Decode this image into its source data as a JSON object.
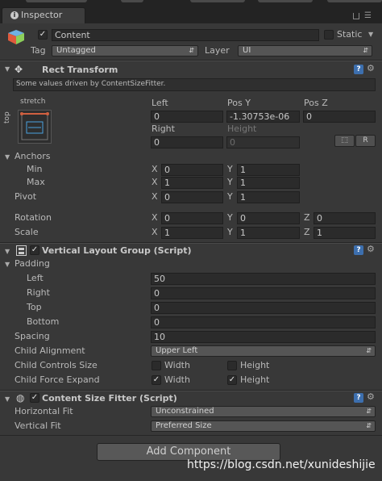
{
  "tab": {
    "title": "Inspector",
    "icon": "info-icon"
  },
  "object": {
    "active_checked": true,
    "name": "Content",
    "static_label": "Static",
    "static_checked": false,
    "tag_label": "Tag",
    "tag_value": "Untagged",
    "layer_label": "Layer",
    "layer_value": "UI"
  },
  "rect_transform": {
    "title": "Rect Transform",
    "notice": "Some values driven by ContentSizeFitter.",
    "anchor_preset_top": "stretch",
    "anchor_preset_side": "top",
    "left_label": "Left",
    "posy_label": "Pos Y",
    "posz_label": "Pos Z",
    "left_value": "0",
    "posy_value": "-1.30753e-06",
    "posz_value": "0",
    "right_label": "Right",
    "height_label": "Height",
    "right_value": "0",
    "height_value": "0",
    "r_button": "R",
    "anchors_label": "Anchors",
    "min_label": "Min",
    "min_x": "0",
    "min_y": "1",
    "max_label": "Max",
    "max_x": "1",
    "max_y": "1",
    "pivot_label": "Pivot",
    "pivot_x": "0",
    "pivot_y": "1",
    "rotation_label": "Rotation",
    "rot_x": "0",
    "rot_y": "0",
    "rot_z": "0",
    "scale_label": "Scale",
    "scale_x": "1",
    "scale_y": "1",
    "scale_z": "1",
    "x": "X",
    "y": "Y",
    "z": "Z"
  },
  "vertical_layout": {
    "title": "Vertical Layout Group (Script)",
    "enabled": true,
    "padding_label": "Padding",
    "left_label": "Left",
    "left_value": "50",
    "right_label": "Right",
    "right_value": "0",
    "top_label": "Top",
    "top_value": "0",
    "bottom_label": "Bottom",
    "bottom_value": "0",
    "spacing_label": "Spacing",
    "spacing_value": "10",
    "child_alignment_label": "Child Alignment",
    "child_alignment_value": "Upper Left",
    "child_controls_label": "Child Controls Size",
    "controls_width_label": "Width",
    "controls_width_checked": false,
    "controls_height_label": "Height",
    "controls_height_checked": false,
    "child_force_label": "Child Force Expand",
    "force_width_label": "Width",
    "force_width_checked": true,
    "force_height_label": "Height",
    "force_height_checked": true
  },
  "size_fitter": {
    "title": "Content Size Fitter (Script)",
    "enabled": true,
    "horizontal_label": "Horizontal Fit",
    "horizontal_value": "Unconstrained",
    "vertical_label": "Vertical Fit",
    "vertical_value": "Preferred Size"
  },
  "add_component": "Add Component",
  "watermark": "https://blog.csdn.net/xunideshijie"
}
